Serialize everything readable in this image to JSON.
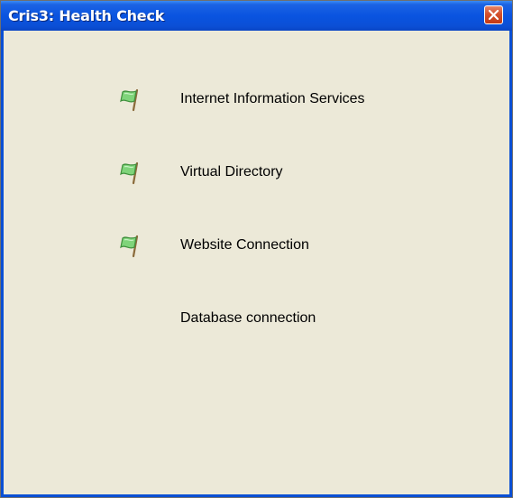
{
  "window": {
    "title": "Cris3: Health Check",
    "close_icon": "close-icon"
  },
  "checks": [
    {
      "label": "Internet Information Services",
      "status_icon": "green-flag-icon",
      "status": "ok"
    },
    {
      "label": "Virtual Directory",
      "status_icon": "green-flag-icon",
      "status": "ok"
    },
    {
      "label": "Website Connection",
      "status_icon": "green-flag-icon",
      "status": "ok"
    },
    {
      "label": "Database connection",
      "status_icon": "",
      "status": "pending"
    }
  ],
  "colors": {
    "titlebar": "#0a54e0",
    "background": "#ece9d8",
    "flag_green": "#6ec96a",
    "close_red": "#d4502c"
  }
}
